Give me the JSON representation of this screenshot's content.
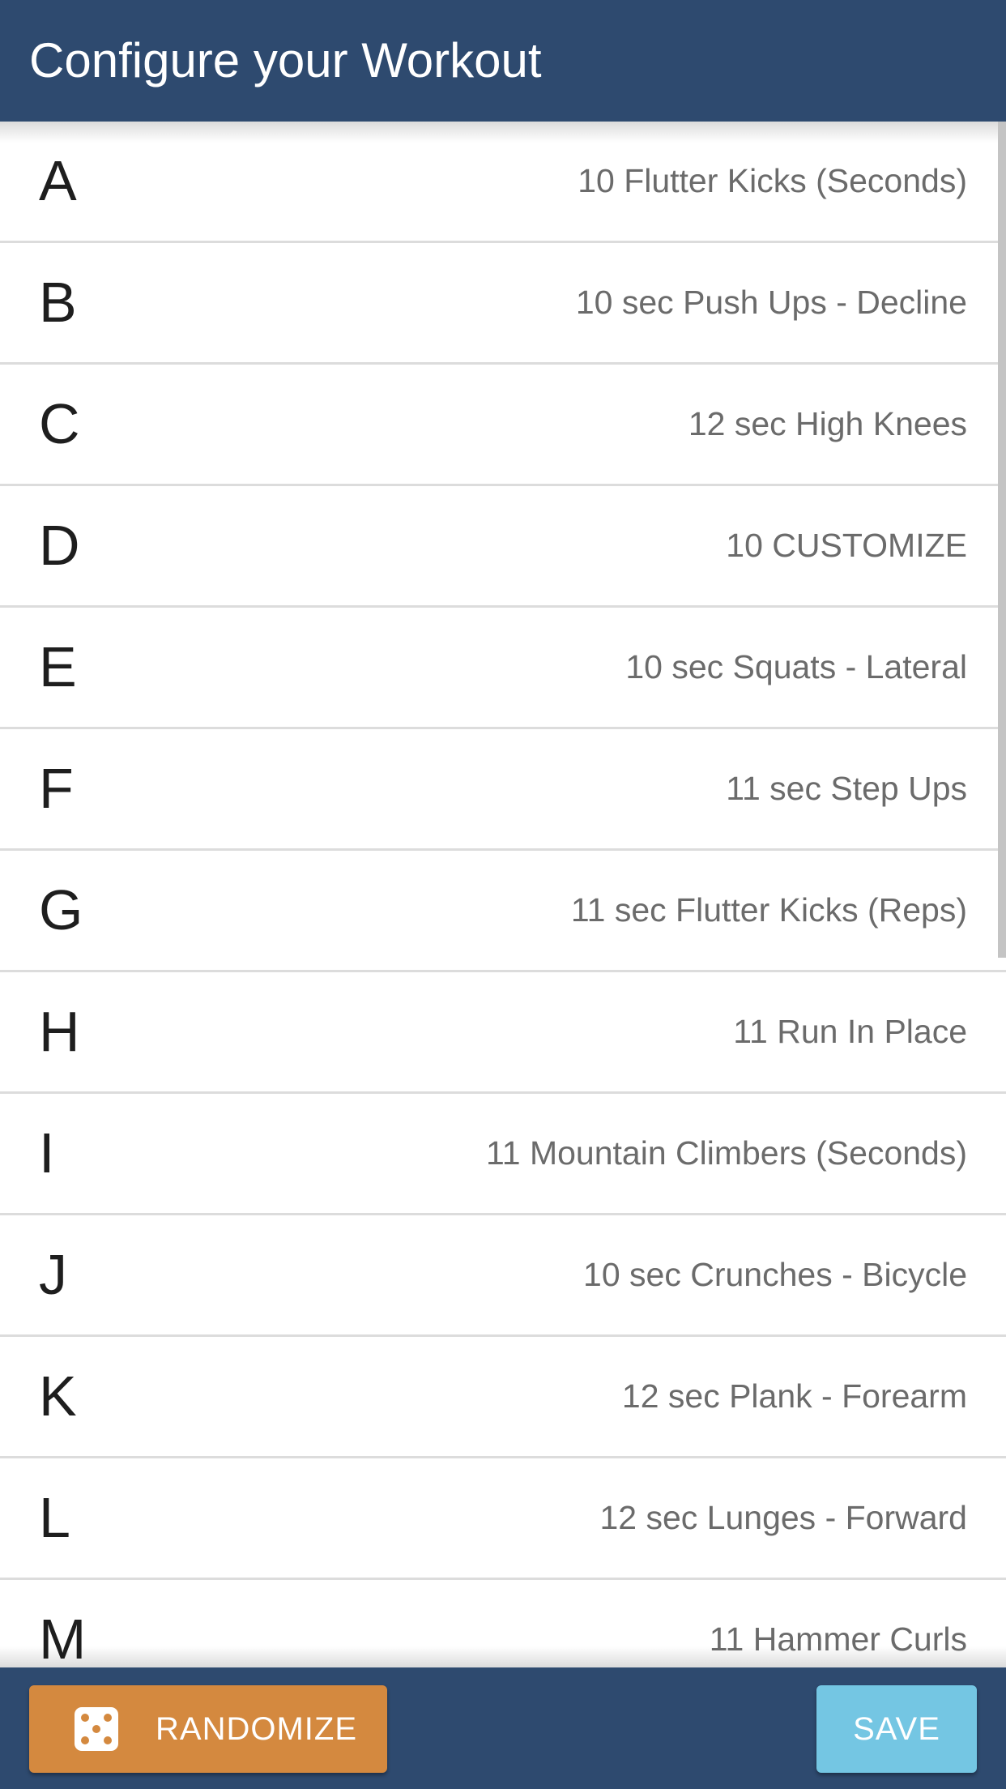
{
  "header": {
    "title": "Configure your Workout"
  },
  "workout": {
    "items": [
      {
        "letter": "A",
        "exercise": "10 Flutter Kicks (Seconds)"
      },
      {
        "letter": "B",
        "exercise": "10 sec Push Ups - Decline"
      },
      {
        "letter": "C",
        "exercise": "12 sec High Knees"
      },
      {
        "letter": "D",
        "exercise": "10 CUSTOMIZE"
      },
      {
        "letter": "E",
        "exercise": "10 sec Squats - Lateral"
      },
      {
        "letter": "F",
        "exercise": "11 sec Step Ups"
      },
      {
        "letter": "G",
        "exercise": "11 sec Flutter Kicks (Reps)"
      },
      {
        "letter": "H",
        "exercise": "11 Run In Place"
      },
      {
        "letter": "I",
        "exercise": "11 Mountain Climbers (Seconds)"
      },
      {
        "letter": "J",
        "exercise": "10 sec Crunches - Bicycle"
      },
      {
        "letter": "K",
        "exercise": "12 sec Plank - Forearm"
      },
      {
        "letter": "L",
        "exercise": "12 sec Lunges - Forward"
      },
      {
        "letter": "M",
        "exercise": "11 Hammer Curls"
      }
    ]
  },
  "footer": {
    "randomize_label": "RANDOMIZE",
    "randomize_icon": "dice-icon",
    "save_label": "SAVE"
  },
  "colors": {
    "primary": "#2e4a6f",
    "randomize": "#d4893f",
    "save": "#74c6e3"
  }
}
